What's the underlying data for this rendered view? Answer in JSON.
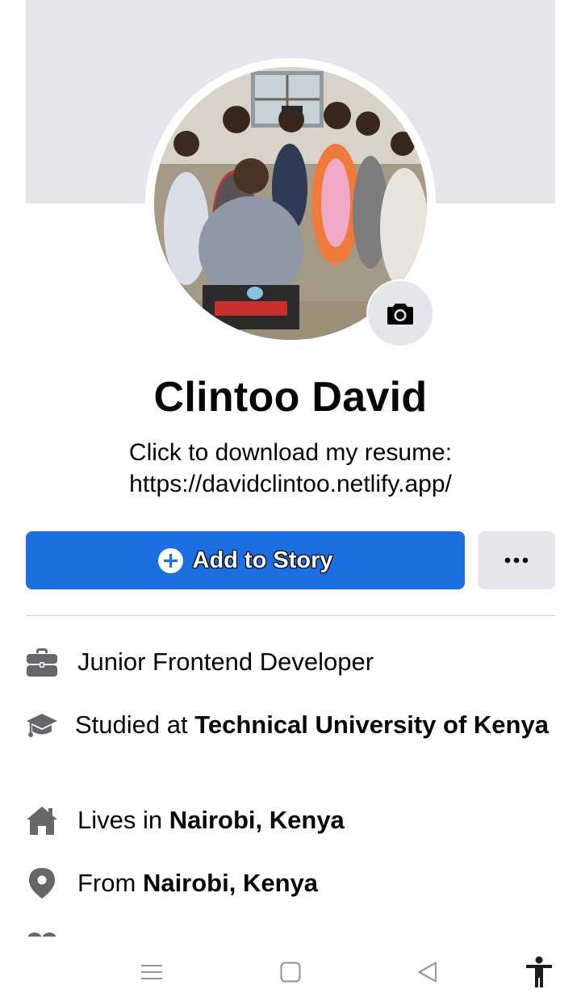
{
  "profile": {
    "name": "Clintoo David",
    "bio_line1": "Click to download my resume:",
    "bio_line2": "https://davidclintoo.netlify.app/"
  },
  "actions": {
    "add_story_label": "Add to Story",
    "more_label": "..."
  },
  "details": {
    "work": "Junior Frontend Developer",
    "education_prefix": "Studied at ",
    "education_place": "Technical University of Kenya",
    "lives_prefix": "Lives in ",
    "lives_place": "Nairobi, Kenya",
    "from_prefix": "From ",
    "from_place": "Nairobi, Kenya"
  },
  "icons": {
    "camera": "camera-icon",
    "plus": "plus-circle-icon",
    "more": "more-dots-icon",
    "work": "briefcase-icon",
    "education": "graduation-cap-icon",
    "lives": "home-icon",
    "from": "location-pin-icon",
    "relationship": "heart-icon",
    "nav_menu": "menu-icon",
    "nav_home": "square-home-icon",
    "nav_back": "back-triangle-icon",
    "nav_accessibility": "accessibility-icon"
  },
  "colors": {
    "accent": "#1b6fe0",
    "cover": "#e4e6eb",
    "icon": "#65676b"
  }
}
